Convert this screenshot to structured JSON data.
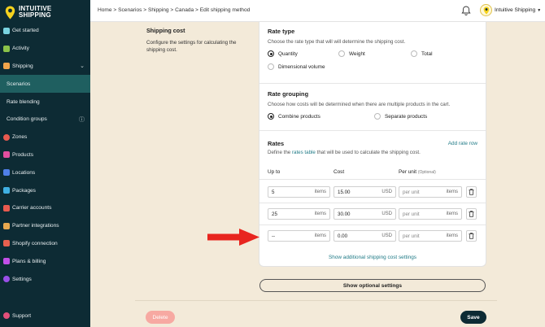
{
  "app": {
    "logo_line1": "INTUITIVE",
    "logo_line2": "SHIPPING"
  },
  "sidebar": {
    "items": [
      {
        "label": "Get started",
        "icon": "rocket-icon",
        "color": "#7ad3e0"
      },
      {
        "label": "Activity",
        "icon": "activity-icon",
        "color": "#8bc34a"
      },
      {
        "label": "Shipping",
        "icon": "truck-icon",
        "color": "#f0a44b",
        "chevron": "⌄"
      },
      {
        "label": "Scenarios",
        "sub": true
      },
      {
        "label": "Rate blending",
        "sub": true
      },
      {
        "label": "Condition groups",
        "sub": true,
        "info": "ⓘ"
      },
      {
        "label": "Zones",
        "icon": "globe-icon",
        "color": "#e85a4f"
      },
      {
        "label": "Products",
        "icon": "shirt-icon",
        "color": "#e24fa0"
      },
      {
        "label": "Locations",
        "icon": "building-icon",
        "color": "#4f7fe8"
      },
      {
        "label": "Packages",
        "icon": "boxes-icon",
        "color": "#3fb0e3"
      },
      {
        "label": "Carrier accounts",
        "icon": "carrier-icon",
        "color": "#e85a4f"
      },
      {
        "label": "Partner integrations",
        "icon": "handshake-icon",
        "color": "#e8a84f"
      },
      {
        "label": "Shopify connection",
        "icon": "shopify-icon",
        "color": "#e8604f"
      },
      {
        "label": "Plans & billing",
        "icon": "card-icon",
        "color": "#c24fe8"
      },
      {
        "label": "Settings",
        "icon": "gear-icon",
        "color": "#9a4fe8"
      }
    ],
    "support_label": "Support"
  },
  "topbar": {
    "breadcrumb": "Home > Scenarios > Shipping > Canada > Edit shipping method",
    "user_label": "Intuitive Shipping"
  },
  "section": {
    "title": "Shipping cost",
    "description": "Configure the settings for calculating the shipping cost."
  },
  "rate_type": {
    "title": "Rate type",
    "description": "Choose the rate type that will will determine the shipping cost.",
    "options": [
      "Quantity",
      "Weight",
      "Total",
      "Dimensional volume"
    ],
    "selected": "Quantity"
  },
  "rate_grouping": {
    "title": "Rate grouping",
    "description": "Choose how costs will be determined when there are multiple products in the cart.",
    "options": [
      "Combine products",
      "Separate products"
    ],
    "selected": "Combine products"
  },
  "rates": {
    "title": "Rates",
    "desc_prefix": "Define the",
    "desc_link": "rates table",
    "desc_suffix": "that will be used to calculate the shipping cost.",
    "add_label": "Add rate row",
    "col_up_to": "Up to",
    "col_cost": "Cost",
    "col_per_unit": "Per unit",
    "col_optional": "(Optional)",
    "rows": [
      {
        "up_to": "5",
        "cost": "15.00",
        "per_unit": "per unit"
      },
      {
        "up_to": "25",
        "cost": "30.00",
        "per_unit": "per unit"
      },
      {
        "up_to": "--",
        "cost": "0.00",
        "per_unit": "per unit"
      }
    ],
    "unit_suffix": "items",
    "currency": "USD",
    "per_unit_suffix": "items",
    "show_more": "Show additional shipping cost settings"
  },
  "buttons": {
    "optional": "Show optional settings",
    "delete": "Delete",
    "save": "Save"
  }
}
